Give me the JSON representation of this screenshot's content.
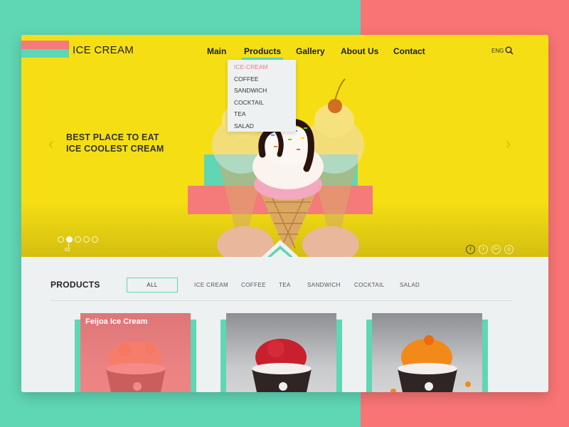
{
  "brand": {
    "name": "ICE CREAM"
  },
  "nav": {
    "items": [
      "Main",
      "Products",
      "Gallery",
      "About Us",
      "Contact"
    ],
    "active": "Products"
  },
  "header": {
    "language": "ENG",
    "search_icon": "search-icon"
  },
  "dropdown": {
    "items": [
      "ICE-CREAM",
      "COFFEE",
      "SANDWICH",
      "COCKTAIL",
      "TEA",
      "SALAD"
    ],
    "active": "ICE-CREAM"
  },
  "hero": {
    "title": "BEST PLACE TO EAT\nICE COOLEST CREAM",
    "prev_icon": "chevron-left-icon",
    "next_icon": "chevron-right-icon",
    "slide_count": 5,
    "active_slide": 2,
    "slide_number": "02",
    "social": [
      {
        "icon": "facebook-icon",
        "glyph": "f"
      },
      {
        "icon": "twitter-icon",
        "glyph": "t"
      },
      {
        "icon": "google-plus-icon",
        "glyph": "G+"
      },
      {
        "icon": "instagram-icon",
        "glyph": "◎"
      }
    ]
  },
  "products": {
    "title": "PRODUCTS",
    "filters": [
      "ALL",
      "ICE CREAM",
      "COFFEE",
      "TEA",
      "SANDWICH",
      "COCKTAIL",
      "SALAD"
    ],
    "active_filter": "ALL",
    "cards": [
      {
        "label": "Feijoa Ice Cream",
        "flavor": "peach",
        "highlighted": true
      },
      {
        "label": "",
        "flavor": "raspberry",
        "highlighted": false
      },
      {
        "label": "",
        "flavor": "orange",
        "highlighted": false
      }
    ]
  },
  "colors": {
    "yellow": "#f5df14",
    "mint": "#5fd6b4",
    "coral": "#f57a7a",
    "panel": "#eef1f2"
  }
}
